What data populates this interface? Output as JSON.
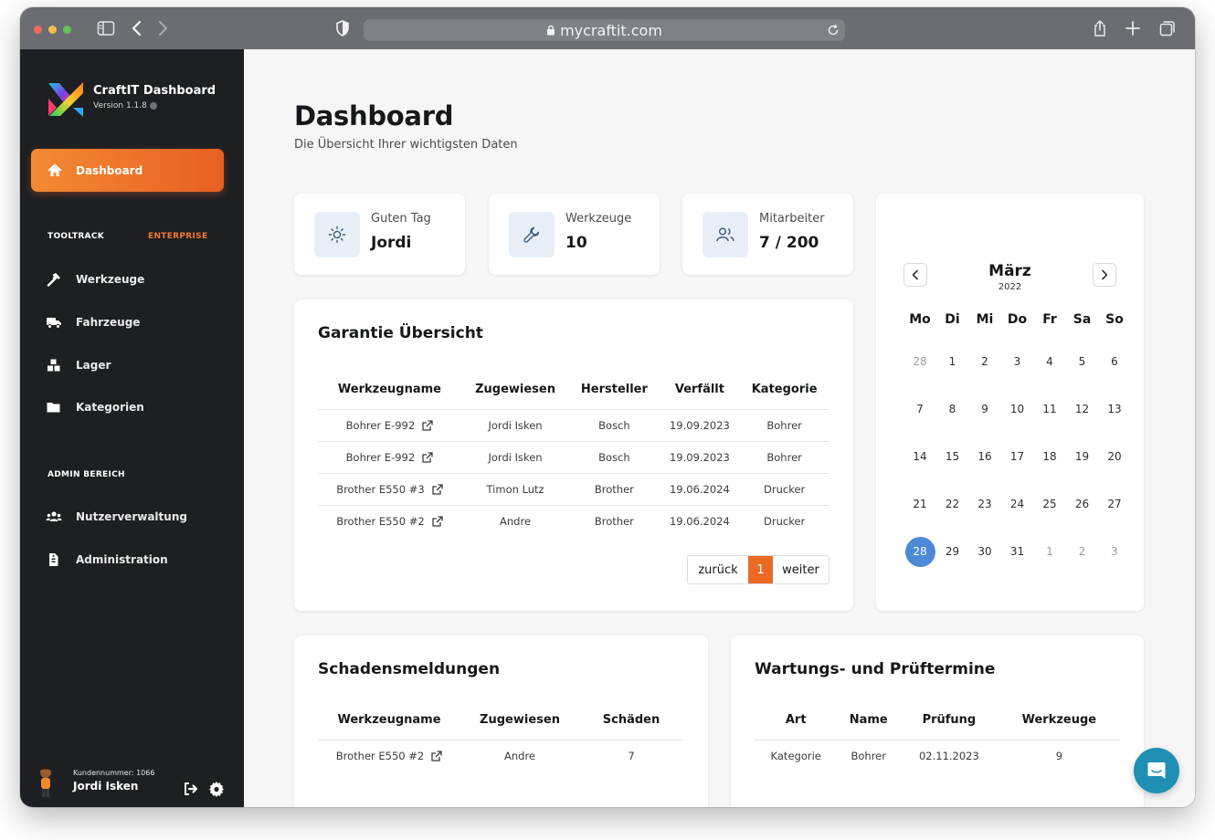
{
  "browser": {
    "url": "mycraftit.com"
  },
  "brand": {
    "title": "CraftIT Dashboard",
    "version": "Version 1.1.8"
  },
  "nav": {
    "active": {
      "label": "Dashboard",
      "icon": "home-icon"
    },
    "section1": {
      "label": "TOOLTRACK",
      "badge": "ENTERPRISE"
    },
    "items1": [
      {
        "label": "Werkzeuge",
        "icon": "hammer-icon"
      },
      {
        "label": "Fahrzeuge",
        "icon": "truck-icon"
      },
      {
        "label": "Lager",
        "icon": "boxes-icon"
      },
      {
        "label": "Kategorien",
        "icon": "folder-icon"
      }
    ],
    "section2": {
      "label": "ADMIN BEREICH"
    },
    "items2": [
      {
        "label": "Nutzerverwaltung",
        "icon": "users-icon"
      },
      {
        "label": "Administration",
        "icon": "file-icon"
      }
    ]
  },
  "user": {
    "customer": "Kundennummer: 1066",
    "name": "Jordi Isken"
  },
  "page": {
    "title": "Dashboard",
    "subtitle": "Die Übersicht Ihrer wichtigsten Daten"
  },
  "stats": [
    {
      "label": "Guten Tag",
      "value": "Jordi",
      "icon": "sun-icon"
    },
    {
      "label": "Werkzeuge",
      "value": "10",
      "icon": "wrench-icon"
    },
    {
      "label": "Mitarbeiter",
      "value": "7 / 200",
      "icon": "users-icon"
    }
  ],
  "warranty": {
    "title": "Garantie Übersicht",
    "columns": [
      "Werkzeugname",
      "Zugewiesen",
      "Hersteller",
      "Verfällt",
      "Kategorie"
    ],
    "rows": [
      [
        "Bohrer E-992",
        "Jordi Isken",
        "Bosch",
        "19.09.2023",
        "Bohrer"
      ],
      [
        "Bohrer E-992",
        "Jordi Isken",
        "Bosch",
        "19.09.2023",
        "Bohrer"
      ],
      [
        "Brother E550 #3",
        "Timon Lutz",
        "Brother",
        "19.06.2024",
        "Drucker"
      ],
      [
        "Brother E550 #2",
        "Andre",
        "Brother",
        "19.06.2024",
        "Drucker"
      ]
    ],
    "pager": {
      "prev": "zurück",
      "page": "1",
      "next": "weiter"
    }
  },
  "calendar": {
    "month": "März",
    "year": "2022",
    "weekdays": [
      "Mo",
      "Di",
      "Mi",
      "Do",
      "Fr",
      "Sa",
      "So"
    ],
    "weeks": [
      [
        "28",
        "1",
        "2",
        "3",
        "4",
        "5",
        "6"
      ],
      [
        "7",
        "8",
        "9",
        "10",
        "11",
        "12",
        "13"
      ],
      [
        "14",
        "15",
        "16",
        "17",
        "18",
        "19",
        "20"
      ],
      [
        "21",
        "22",
        "23",
        "24",
        "25",
        "26",
        "27"
      ],
      [
        "28",
        "29",
        "30",
        "31",
        "1",
        "2",
        "3"
      ]
    ],
    "today": "28"
  },
  "damage": {
    "title": "Schadensmeldungen",
    "columns": [
      "Werkzeugname",
      "Zugewiesen",
      "Schäden"
    ],
    "rows": [
      [
        "Brother E550 #2",
        "Andre",
        "7"
      ]
    ]
  },
  "maintenance": {
    "title": "Wartungs- und Prüftermine",
    "columns": [
      "Art",
      "Name",
      "Prüfung",
      "Werkzeuge"
    ],
    "rows": [
      [
        "Kategorie",
        "Bohrer",
        "02.11.2023",
        "9"
      ]
    ]
  },
  "colors": {
    "accent": "#ee7428",
    "sidebar": "#1d1f23",
    "today": "#4d8ad6",
    "chat": "#1f8fb4"
  }
}
